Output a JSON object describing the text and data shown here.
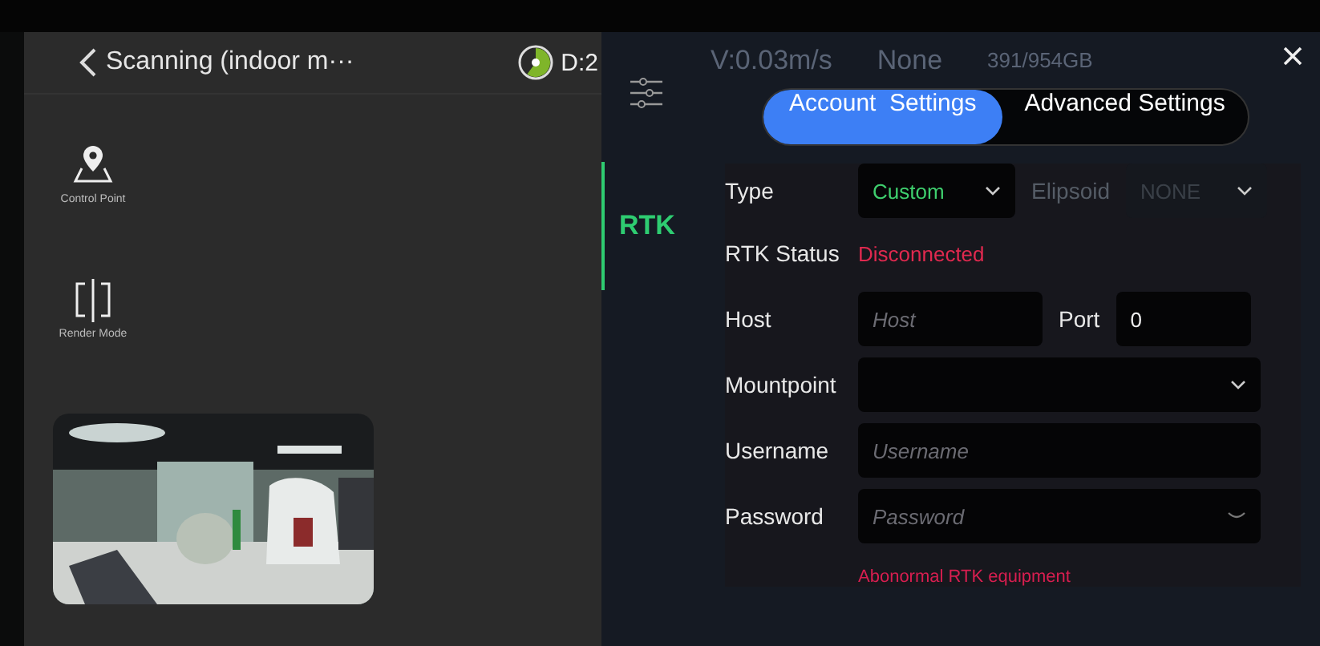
{
  "header": {
    "title": "Scanning (indoor m···",
    "progress": {
      "level": 0.6
    },
    "distance": "D:2"
  },
  "tools": [
    {
      "kind": "pin",
      "label": "Control Point"
    },
    {
      "kind": "split",
      "label": "Render Mode"
    }
  ],
  "status_background": [
    "V:0.03m/s",
    "None",
    "391/954GB"
  ],
  "settings": {
    "side_tabs": [
      {
        "label": "RTK",
        "selected": true
      }
    ],
    "tabs": [
      {
        "label": "Account  Settings",
        "selected": true
      },
      {
        "label": "Advanced Settings",
        "selected": false
      }
    ],
    "rows": [
      {
        "kind": "select_pair",
        "label": "Type",
        "value": "Custom",
        "label_2": "Elipsoid",
        "value_2": "NONE",
        "disabled_2": true
      },
      {
        "kind": "status",
        "label": "RTK Status",
        "value": "Disconnected"
      },
      {
        "kind": "input_pair",
        "label": "Host",
        "placeholder": "Host",
        "label_2": "Port",
        "value_2": "0"
      },
      {
        "kind": "select",
        "label": "Mountpoint"
      },
      {
        "kind": "input",
        "label": "Username",
        "placeholder": "Username"
      },
      {
        "kind": "password",
        "label": "Password",
        "placeholder": "Password"
      }
    ],
    "error": "Abonormal RTK equipment"
  }
}
